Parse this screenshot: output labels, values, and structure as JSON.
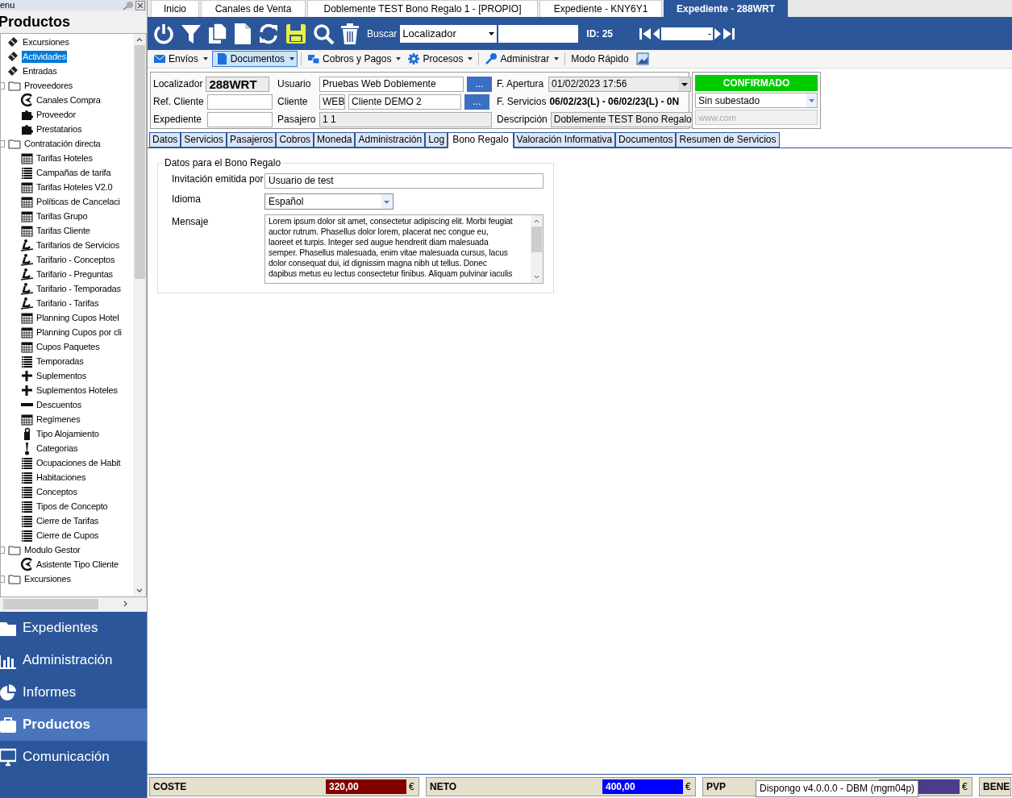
{
  "panel": {
    "header": "enu",
    "title": "Productos"
  },
  "tree": [
    {
      "label": "Excursiones",
      "kind": "ticket",
      "selected": false
    },
    {
      "label": "Actividades",
      "kind": "ticket",
      "selected": true
    },
    {
      "label": "Entradas",
      "kind": "ticket",
      "selected": false
    },
    {
      "label": "Proveedores",
      "kind": "folder",
      "selected": false,
      "children": [
        {
          "label": "Canales Compra",
          "kind": "gauge",
          "selected": false
        },
        {
          "label": "Proveedor",
          "kind": "puzzle",
          "selected": false
        },
        {
          "label": "Prestatarios",
          "kind": "puzzle",
          "selected": false
        }
      ]
    },
    {
      "label": "Contratación directa",
      "kind": "folder",
      "selected": false,
      "children": [
        {
          "label": "Tarifas Hoteles",
          "kind": "calendar",
          "selected": false
        },
        {
          "label": "Campañas de tarifa",
          "kind": "list",
          "selected": false
        },
        {
          "label": "Tarifas Hoteles V2.0",
          "kind": "calendar",
          "selected": false
        },
        {
          "label": "Políticas de Cancelaci",
          "kind": "calendar",
          "selected": false
        },
        {
          "label": "Tarifas Grupo",
          "kind": "calendar",
          "selected": false
        },
        {
          "label": "Tarifas Cliente",
          "kind": "calendar",
          "selected": false
        },
        {
          "label": "Tarifarios de Servicios",
          "kind": "skier",
          "selected": false
        },
        {
          "label": "Tarifario - Conceptos",
          "kind": "skier",
          "selected": false
        },
        {
          "label": "Tarifario - Preguntas",
          "kind": "skier",
          "selected": false
        },
        {
          "label": "Tarifario - Temporadas",
          "kind": "skier",
          "selected": false
        },
        {
          "label": "Tarifario - Tarifas",
          "kind": "skier",
          "selected": false
        },
        {
          "label": "Planning Cupos Hotel",
          "kind": "calendar",
          "selected": false
        },
        {
          "label": "Planning Cupos por cli",
          "kind": "calendar",
          "selected": false
        },
        {
          "label": "Cupos Paquetes",
          "kind": "calendar",
          "selected": false
        },
        {
          "label": "Temporadas",
          "kind": "list",
          "selected": false
        },
        {
          "label": "Suplementos",
          "kind": "plus",
          "selected": false
        },
        {
          "label": "Suplementos Hoteles",
          "kind": "plus",
          "selected": false
        },
        {
          "label": "Descuentos",
          "kind": "minus",
          "selected": false
        },
        {
          "label": "Regímenes",
          "kind": "calendar",
          "selected": false
        },
        {
          "label": "Tipo Alojamiento",
          "kind": "doorhanger",
          "selected": false
        },
        {
          "label": "Categorias",
          "kind": "exclamation",
          "selected": false
        },
        {
          "label": "Ocupaciones de Habit",
          "kind": "list",
          "selected": false
        },
        {
          "label": "Habitaciones",
          "kind": "list",
          "selected": false
        },
        {
          "label": "Conceptos",
          "kind": "list",
          "selected": false
        },
        {
          "label": "Tipos de Concepto",
          "kind": "list",
          "selected": false
        },
        {
          "label": "Cierre de Tarifas",
          "kind": "list",
          "selected": false
        },
        {
          "label": "Cierre de Cupos",
          "kind": "list",
          "selected": false
        }
      ]
    },
    {
      "label": "Modulo Gestor",
      "kind": "folder",
      "selected": false,
      "children": [
        {
          "label": "Asistente Tipo Cliente",
          "kind": "gauge",
          "selected": false
        }
      ]
    },
    {
      "label": "Excursiones",
      "kind": "folder",
      "selected": false
    }
  ],
  "nav": [
    {
      "label": "Expedientes",
      "kind": "folder",
      "selected": false
    },
    {
      "label": "Administración",
      "kind": "bars",
      "selected": false
    },
    {
      "label": "Informes",
      "kind": "pie",
      "selected": false
    },
    {
      "label": "Productos",
      "kind": "case",
      "selected": true
    },
    {
      "label": "Comunicación",
      "kind": "monitor",
      "selected": false
    }
  ],
  "doc_tabs": [
    {
      "label": "Inicio",
      "selected": false
    },
    {
      "label": "Canales de Venta",
      "selected": false
    },
    {
      "label": "Doblemente TEST Bono Regalo 1 - [PROPIO]",
      "selected": false
    },
    {
      "label": "Expediente  - KNY6Y1",
      "selected": false
    },
    {
      "label": "Expediente  - 288WRT",
      "selected": true
    }
  ],
  "search": {
    "label": "Buscar",
    "field": "Localizador",
    "id": "ID: 25",
    "nav_value": "-"
  },
  "menu": [
    {
      "label": "Envíos",
      "kind": "mail",
      "dropdown": true,
      "selected": false
    },
    {
      "label": "Documentos",
      "kind": "pdf",
      "dropdown": true,
      "selected": true
    },
    {
      "label": "Cobros y Pagos",
      "kind": "money",
      "dropdown": true,
      "selected": false
    },
    {
      "label": "Procesos",
      "kind": "gear",
      "dropdown": true,
      "selected": false
    },
    {
      "label": "Administrar",
      "kind": "key",
      "dropdown": true,
      "selected": false
    },
    {
      "label": "Modo Rápido",
      "kind": "none",
      "dropdown": false,
      "selected": false
    }
  ],
  "header": {
    "localizador": {
      "label": "Localizador",
      "value": "288WRT"
    },
    "ref_cliente": {
      "label": "Ref. Cliente"
    },
    "expediente": {
      "label": "Expediente"
    },
    "usuario": {
      "label": "Usuario",
      "value": "Pruebas Web Doblemente",
      "button": "..."
    },
    "cliente": {
      "label": "Cliente",
      "code": "WEB",
      "value": "Cliente DEMO 2",
      "button": "..."
    },
    "pasajero": {
      "label": "Pasajero",
      "value": "1 1"
    },
    "apertura": {
      "label": "F. Apertura",
      "value": "01/02/2023 17:56"
    },
    "servicios": {
      "label": "F.  Servicios",
      "value": "06/02/23(L) - 06/02/23(L) - 0N"
    },
    "descripcion": {
      "label": "Descripción",
      "value": "Doblemente TEST Bono Regalo"
    },
    "status": "CONFIRMADO",
    "substatus": "Sin subestado",
    "web_placeholder": "www.com"
  },
  "record_tabs": [
    {
      "label": "Datos",
      "selected": false
    },
    {
      "label": "Servicios",
      "selected": false
    },
    {
      "label": "Pasajeros",
      "selected": false
    },
    {
      "label": "Cobros",
      "selected": false
    },
    {
      "label": "Moneda",
      "selected": false
    },
    {
      "label": "Administración",
      "selected": false
    },
    {
      "label": "Log",
      "selected": false
    },
    {
      "label": "Bono Regalo",
      "selected": true
    },
    {
      "label": "Valoración Informativa",
      "selected": false
    },
    {
      "label": "Documentos",
      "selected": false
    },
    {
      "label": "Resumen de Servicios",
      "selected": false
    }
  ],
  "bono": {
    "legend": "Datos para el Bono Regalo",
    "invitacion": {
      "label": "Invitación emitida por",
      "value": "Usuario de test"
    },
    "idioma": {
      "label": "Idioma",
      "value": "Español"
    },
    "mensaje": {
      "label": "Mensaje",
      "lines": [
        "Lorem ipsum dolor sit amet, consectetur adipiscing elit. Morbi feugiat",
        "auctor rutrum. Phasellus dolor lorem, placerat nec congue eu,",
        "laoreet et turpis. Integer sed augue hendrerit diam malesuada",
        "semper. Phasellus malesuada, enim vitae malesuada cursus, lacus",
        "dolor consequat dui, id dignissim magna nibh ut tellus. Donec",
        "dapibus metus eu lectus consectetur finibus. Aliquam pulvinar iaculis"
      ]
    }
  },
  "totals": [
    {
      "label": "COSTE",
      "value": "320,00",
      "color": "#800000",
      "currency": "€"
    },
    {
      "label": "NETO",
      "value": "400,00",
      "color": "#0000ff",
      "currency": "€"
    },
    {
      "label": "PVP",
      "color": "#483d8b",
      "currency": "€"
    },
    {
      "label": "BENE"
    }
  ],
  "tooltip": "Dispongo v4.0.0.0 - DBM (mgm04p)"
}
